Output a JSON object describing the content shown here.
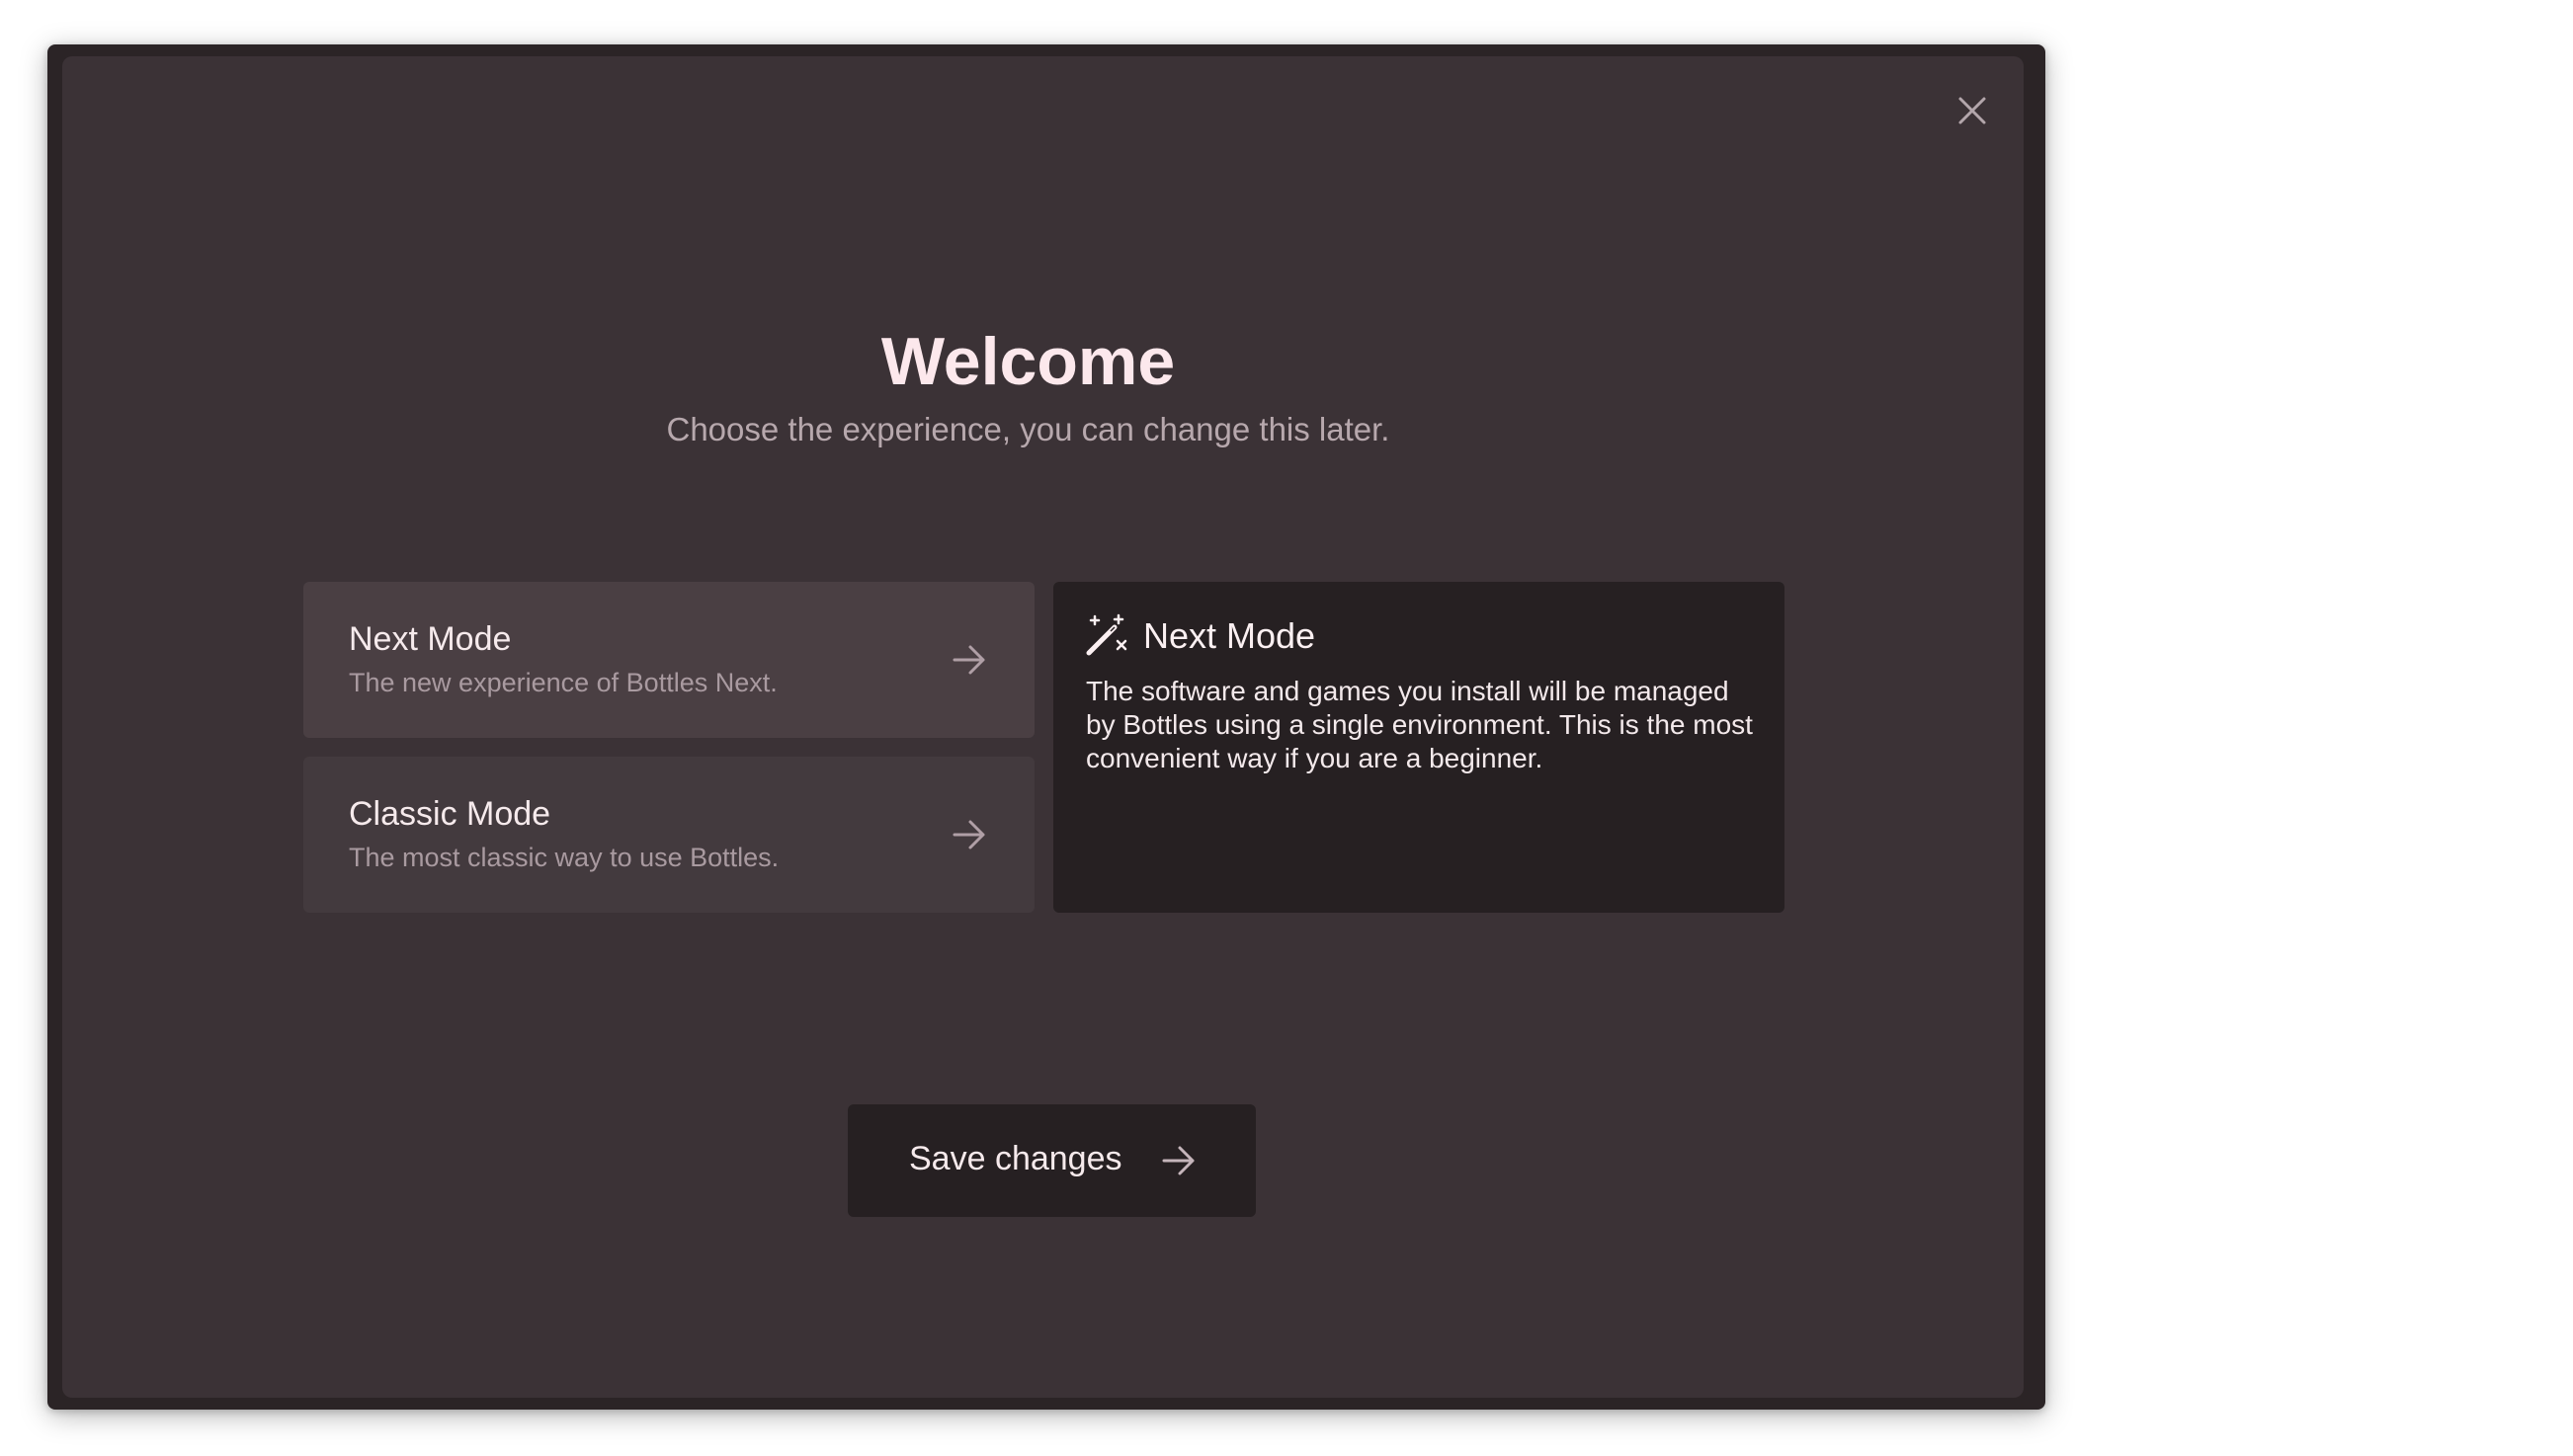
{
  "welcome": {
    "title": "Welcome",
    "subtitle": "Choose the experience, you can change this later."
  },
  "options": [
    {
      "title": "Next Mode",
      "description": "The new experience of Bottles Next."
    },
    {
      "title": "Classic Mode",
      "description": "The most classic way to use Bottles."
    }
  ],
  "info": {
    "icon": "magic-wand-icon",
    "title": "Next Mode",
    "text": "The software and games you install will be managed by Bottles using a single environment. This is the most convenient way if you are a beginner."
  },
  "footer": {
    "save_label": "Save changes"
  },
  "colors": {
    "window_bg": "#2b2426",
    "panel_bg": "#3b3236",
    "card_bg": "#4a3f43",
    "dark_bg": "#262022",
    "title_color": "#fce8ec"
  }
}
